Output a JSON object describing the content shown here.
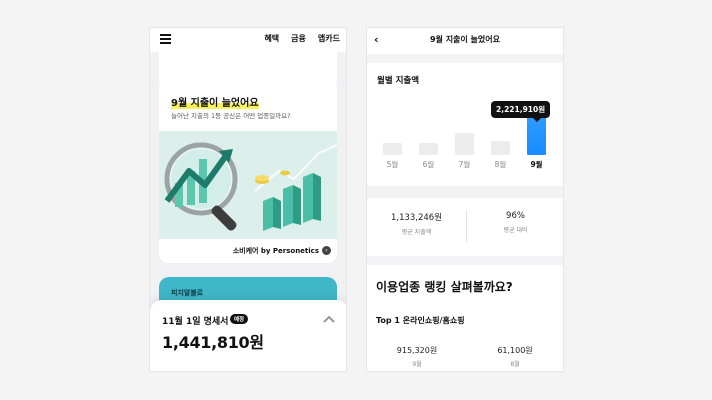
{
  "left": {
    "menu_icon": "hamburger-icon",
    "nav": [
      "혜택",
      "금융",
      "앱카드"
    ],
    "card": {
      "title": "9월 지출이 늘었어요",
      "subtitle": "늘어난 지출의 1등 공신은 어떤 업종일까요?",
      "footer": "소비케어 by Personetics",
      "footer_icon": "chevron-right-icon"
    },
    "next_card_label": "피지알볼로",
    "statement": {
      "title": "11월 1일 명세서",
      "badge": "예정",
      "amount": "1,441,810원",
      "toggle_icon": "chevron-up-icon"
    }
  },
  "right": {
    "back_icon": "chevron-left-icon",
    "title": "9월 지출이 늘었어요",
    "chart_title": "월별 지출액",
    "tooltip": "2,221,910원",
    "chart_data": {
      "type": "bar",
      "categories": [
        "5월",
        "6월",
        "7월",
        "8월",
        "9월"
      ],
      "values": [
        0.3,
        0.3,
        0.55,
        0.35,
        1.0
      ],
      "highlight_index": 4,
      "bar_color": "#ececec",
      "highlight_color": "#1a8cff"
    },
    "stats": [
      {
        "value": "1,133,246원",
        "label": "평균 지출액"
      },
      {
        "value": "96%",
        "label": "평균 대비"
      }
    ],
    "ranking": {
      "heading": "이용업종 랭킹 살펴볼까요?",
      "top_label": "Top 1 온라인쇼핑/홈쇼핑",
      "items": [
        {
          "amount": "915,320원",
          "month": "9월"
        },
        {
          "amount": "61,100원",
          "month": "8월"
        }
      ]
    }
  },
  "colors": {
    "accent": "#1a8cff",
    "highlight": "#f7f15b",
    "teal": "#3fb7c9"
  }
}
